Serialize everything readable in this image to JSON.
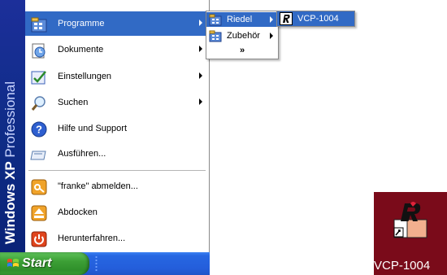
{
  "banner": {
    "text_bold": "Windows XP",
    "text_light": "Professional"
  },
  "menu": {
    "items": [
      {
        "label": "Programme",
        "icon": "programs-icon"
      },
      {
        "label": "Dokumente",
        "icon": "documents-icon"
      },
      {
        "label": "Einstellungen",
        "icon": "settings-icon"
      },
      {
        "label": "Suchen",
        "icon": "search-icon"
      },
      {
        "label": "Hilfe und Support",
        "icon": "help-icon"
      },
      {
        "label": "Ausführen...",
        "icon": "run-icon"
      },
      {
        "label": "\"franke\" abmelden...",
        "icon": "logoff-icon"
      },
      {
        "label": "Abdocken",
        "icon": "eject-icon"
      },
      {
        "label": "Herunterfahren...",
        "icon": "shutdown-icon"
      }
    ]
  },
  "submenu_programme": {
    "items": [
      {
        "label": "Riedel",
        "icon": "program-group-icon"
      },
      {
        "label": "Zubehör",
        "icon": "program-group-icon"
      }
    ],
    "expand": "»"
  },
  "submenu_riedel": {
    "items": [
      {
        "label": "VCP-1004",
        "icon": "riedel-app-icon"
      }
    ]
  },
  "taskbar": {
    "start_label": "Start"
  },
  "desktop": {
    "icon_label": "VCP-1004"
  },
  "colors": {
    "highlight": "#316ac5",
    "banner": "#0e2c86",
    "taskbar": "#245edb",
    "start_button": "#3c9f35",
    "desktop_tile": "#7a0b1a"
  }
}
